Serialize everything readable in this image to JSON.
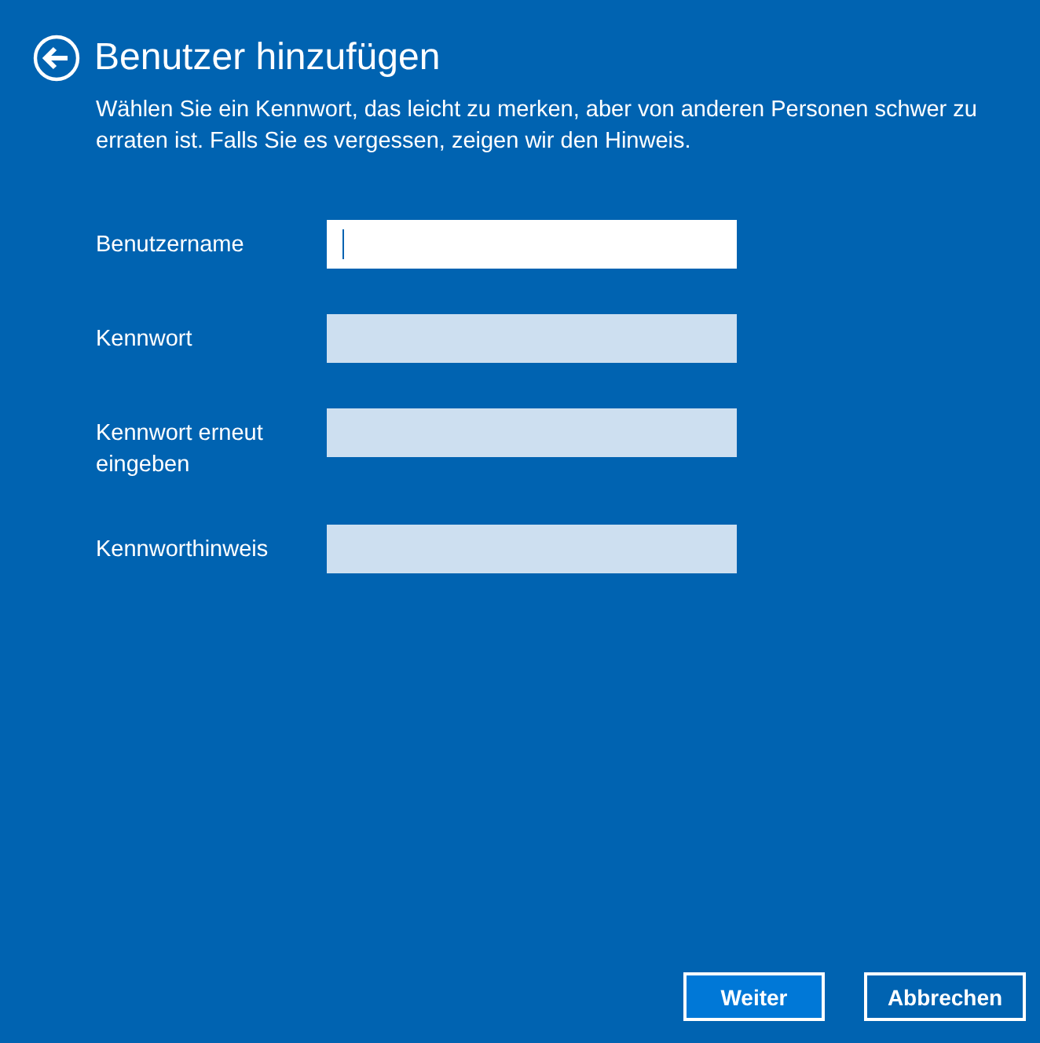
{
  "header": {
    "title": "Benutzer hinzufügen",
    "description": "Wählen Sie ein Kennwort, das leicht zu merken, aber von anderen Personen schwer zu erraten ist. Falls Sie es vergessen, zeigen wir den Hinweis."
  },
  "fields": [
    {
      "label": "Benutzername",
      "focused": true
    },
    {
      "label": "Kennwort",
      "focused": false
    },
    {
      "label": "Kennwort erneut eingeben",
      "focused": false
    },
    {
      "label": "Kennworthinweis",
      "focused": false
    }
  ],
  "buttons": [
    {
      "label": "Weiter",
      "kind": "primary"
    },
    {
      "label": "Abbrechen",
      "kind": "secondary"
    }
  ]
}
